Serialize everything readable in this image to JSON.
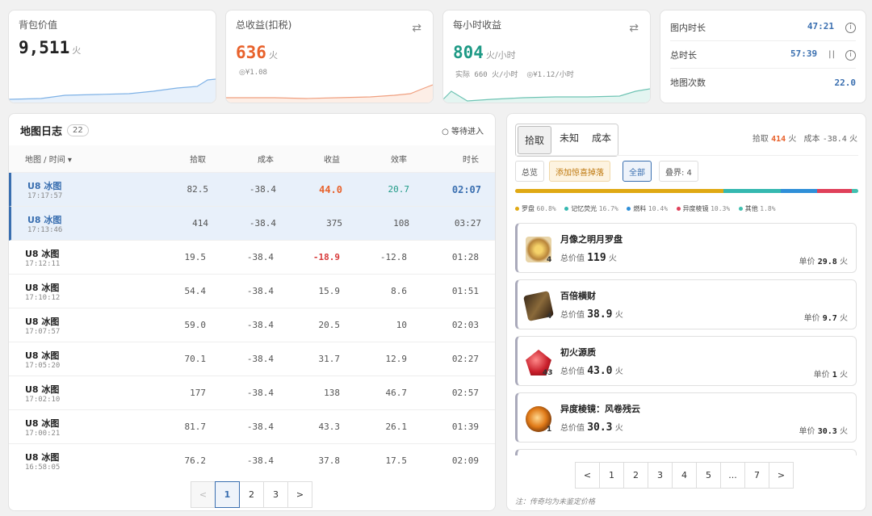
{
  "stats": {
    "bag": {
      "label": "背包价值",
      "value": "9,511",
      "unit": "火"
    },
    "total": {
      "label": "总收益(扣税)",
      "value": "636",
      "unit": "火",
      "sub": "¥1.08"
    },
    "hourly": {
      "label": "每小时收益",
      "value": "804",
      "unit": "火/小时",
      "sub1": "实际 660 火/小时",
      "sub2": "¥1.12/小时"
    },
    "times": {
      "map_time_label": "图内时长",
      "map_time": "47:21",
      "total_time_label": "总时长",
      "total_time": "57:39",
      "map_count_label": "地图次数",
      "map_count": "22.0"
    }
  },
  "log": {
    "title": "地图日志",
    "count": "22",
    "status": "等待进入",
    "headers": [
      "地图 / 时间 ▾",
      "拾取",
      "成本",
      "收益",
      "效率",
      "时长"
    ],
    "rows": [
      {
        "name": "U8 冰图",
        "time": "17:17:57",
        "pick": "82.5",
        "cost": "-38.4",
        "profit": "44.0",
        "eff": "20.7",
        "dur": "02:07"
      },
      {
        "name": "U8 冰图",
        "time": "17:13:46",
        "pick": "414",
        "cost": "-38.4",
        "profit": "375",
        "eff": "108",
        "dur": "03:27"
      },
      {
        "name": "U8 冰图",
        "time": "17:12:11",
        "pick": "19.5",
        "cost": "-38.4",
        "profit": "-18.9",
        "eff": "-12.8",
        "dur": "01:28"
      },
      {
        "name": "U8 冰图",
        "time": "17:10:12",
        "pick": "54.4",
        "cost": "-38.4",
        "profit": "15.9",
        "eff": "8.6",
        "dur": "01:51"
      },
      {
        "name": "U8 冰图",
        "time": "17:07:57",
        "pick": "59.0",
        "cost": "-38.4",
        "profit": "20.5",
        "eff": "10",
        "dur": "02:03"
      },
      {
        "name": "U8 冰图",
        "time": "17:05:20",
        "pick": "70.1",
        "cost": "-38.4",
        "profit": "31.7",
        "eff": "12.9",
        "dur": "02:27"
      },
      {
        "name": "U8 冰图",
        "time": "17:02:10",
        "pick": "177",
        "cost": "-38.4",
        "profit": "138",
        "eff": "46.7",
        "dur": "02:57"
      },
      {
        "name": "U8 冰图",
        "time": "17:00:21",
        "pick": "81.7",
        "cost": "-38.4",
        "profit": "43.3",
        "eff": "26.1",
        "dur": "01:39"
      },
      {
        "name": "U8 冰图",
        "time": "16:58:05",
        "pick": "76.2",
        "cost": "-38.4",
        "profit": "37.8",
        "eff": "17.5",
        "dur": "02:09"
      }
    ],
    "pager": [
      "<",
      "1",
      "2",
      "3",
      ">"
    ]
  },
  "detail": {
    "tabs": [
      "拾取",
      "未知",
      "成本"
    ],
    "summary": {
      "pick_label": "拾取",
      "pick": "414",
      "unit": "火",
      "cost_label": "成本",
      "cost": "-38.4"
    },
    "filters": [
      "总览",
      "添加惊喜掉落",
      "全部",
      "叠界: 4"
    ],
    "legend": [
      {
        "name": "罗盘",
        "pct": "60.8%",
        "color": "#e0a914",
        "share": 60.8
      },
      {
        "name": "记忆荧光",
        "pct": "16.7%",
        "color": "#35b8b0",
        "share": 16.7
      },
      {
        "name": "燃料",
        "pct": "10.4%",
        "color": "#2f8fd8",
        "share": 10.4
      },
      {
        "name": "异度棱镜",
        "pct": "10.3%",
        "color": "#e0405a",
        "share": 10.3
      },
      {
        "name": "其他",
        "pct": "1.8%",
        "color": "#40c0b0",
        "share": 1.8
      }
    ],
    "items": [
      {
        "name": "月像之明月罗盘",
        "qty": "4",
        "total_label": "总价值",
        "total": "119",
        "unit": "火",
        "unit_label": "单价",
        "unit_price": "29.8"
      },
      {
        "name": "百倍横财",
        "qty": "4",
        "total_label": "总价值",
        "total": "38.9",
        "unit": "火",
        "unit_label": "单价",
        "unit_price": "9.7"
      },
      {
        "name": "初火源质",
        "qty": "43",
        "total_label": "总价值",
        "total": "43.0",
        "unit": "火",
        "unit_label": "单价",
        "unit_price": "1"
      },
      {
        "name": "异度棱镜：风卷残云",
        "qty": "1",
        "total_label": "总价值",
        "total": "30.3",
        "unit": "火",
        "unit_label": "单价",
        "unit_price": "30.3"
      }
    ],
    "pager": [
      "<",
      "1",
      "2",
      "3",
      "4",
      "5",
      "...",
      "7",
      ">"
    ],
    "note": "注：传奇均为未鉴定价格"
  },
  "colors": {
    "accent": "#3a6fb0",
    "orange": "#e8622c",
    "teal": "#1f9a86",
    "negative": "#d83a3a"
  }
}
